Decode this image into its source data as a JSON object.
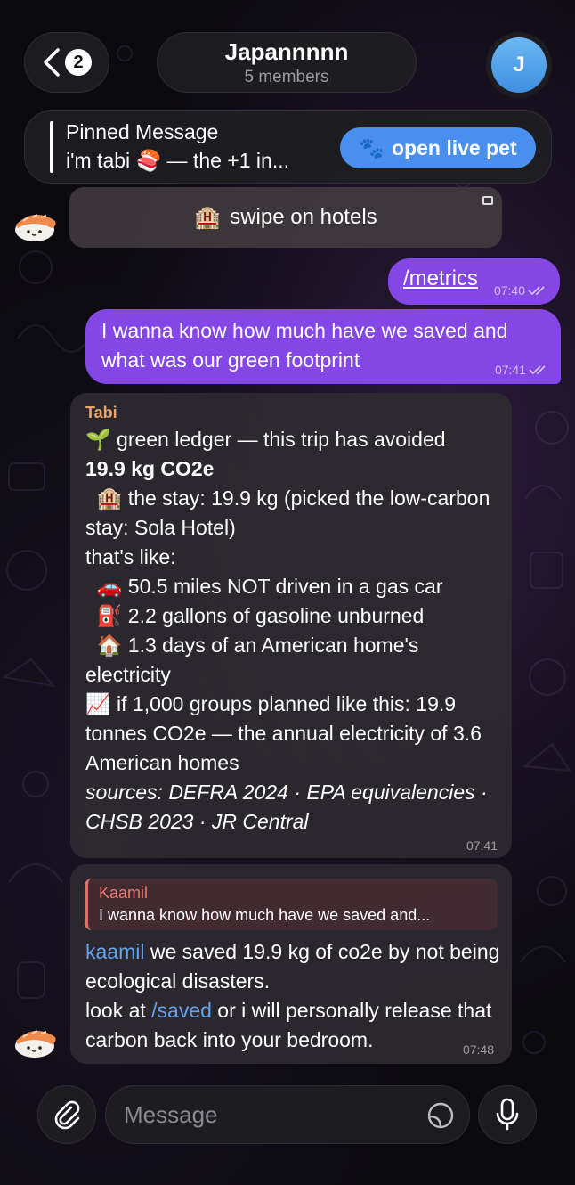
{
  "header": {
    "back_badge": "2",
    "chat_title": "Japannnnn",
    "chat_subtitle": "5 members",
    "avatar_initial": "J"
  },
  "pinned": {
    "title": "Pinned Message",
    "text": "i'm tabi 🍣 — the +1 in...",
    "button_emoji": "🐾",
    "button_label": "open live pet"
  },
  "bot_button": {
    "emoji": "🏨",
    "label": "swipe on hotels"
  },
  "messages": {
    "m1": {
      "text": "/metrics",
      "time": "07:40"
    },
    "m2": {
      "text": "I wanna know how much have we saved and what was our green footprint",
      "time": "07:41"
    },
    "m3": {
      "sender": "Tabi",
      "lines": {
        "l1": "🌱 green ledger — this trip has avoided",
        "l2": "19.9 kg CO2e",
        "l3": "  🏨 the stay: 19.9 kg (picked the low-carbon stay: Sola Hotel)",
        "l4": "that's like:",
        "l5": "  🚗 50.5 miles NOT driven in a gas car",
        "l6": "  ⛽ 2.2 gallons of gasoline unburned",
        "l7": "  🏠 1.3 days of an American home's electricity",
        "l8": "📈 if 1,000 groups planned like this: 19.9 tonnes CO2e — the annual electricity of 3.6 American homes",
        "l9": "sources: DEFRA 2024 · EPA equivalencies · CHSB 2023 · JR Central"
      },
      "time": "07:41"
    },
    "m4": {
      "reply_name": "Kaamil",
      "reply_text": "I wanna know how much have we saved and...",
      "mention": "kaamil",
      "text_a": " we saved 19.9 kg of co2e by not being ecological disasters.",
      "text_b": "look at ",
      "command": "/saved",
      "text_c": " or i will personally release that carbon back into your bedroom.",
      "time": "07:48"
    }
  },
  "composer": {
    "placeholder": "Message"
  },
  "colors": {
    "outgoing_bubble": "#8447e6",
    "incoming_bubble": "#2c292f",
    "link": "#64a4ef",
    "sender_tabi": "#e9a56b",
    "reply_accent": "#e06c6c",
    "pin_button": "#4a8fee"
  },
  "icons": [
    "chevron-left-icon",
    "paperclip-icon",
    "sticker-icon",
    "microphone-icon",
    "double-check-icon",
    "keyboard-button-icon",
    "sushi-avatar-icon"
  ]
}
